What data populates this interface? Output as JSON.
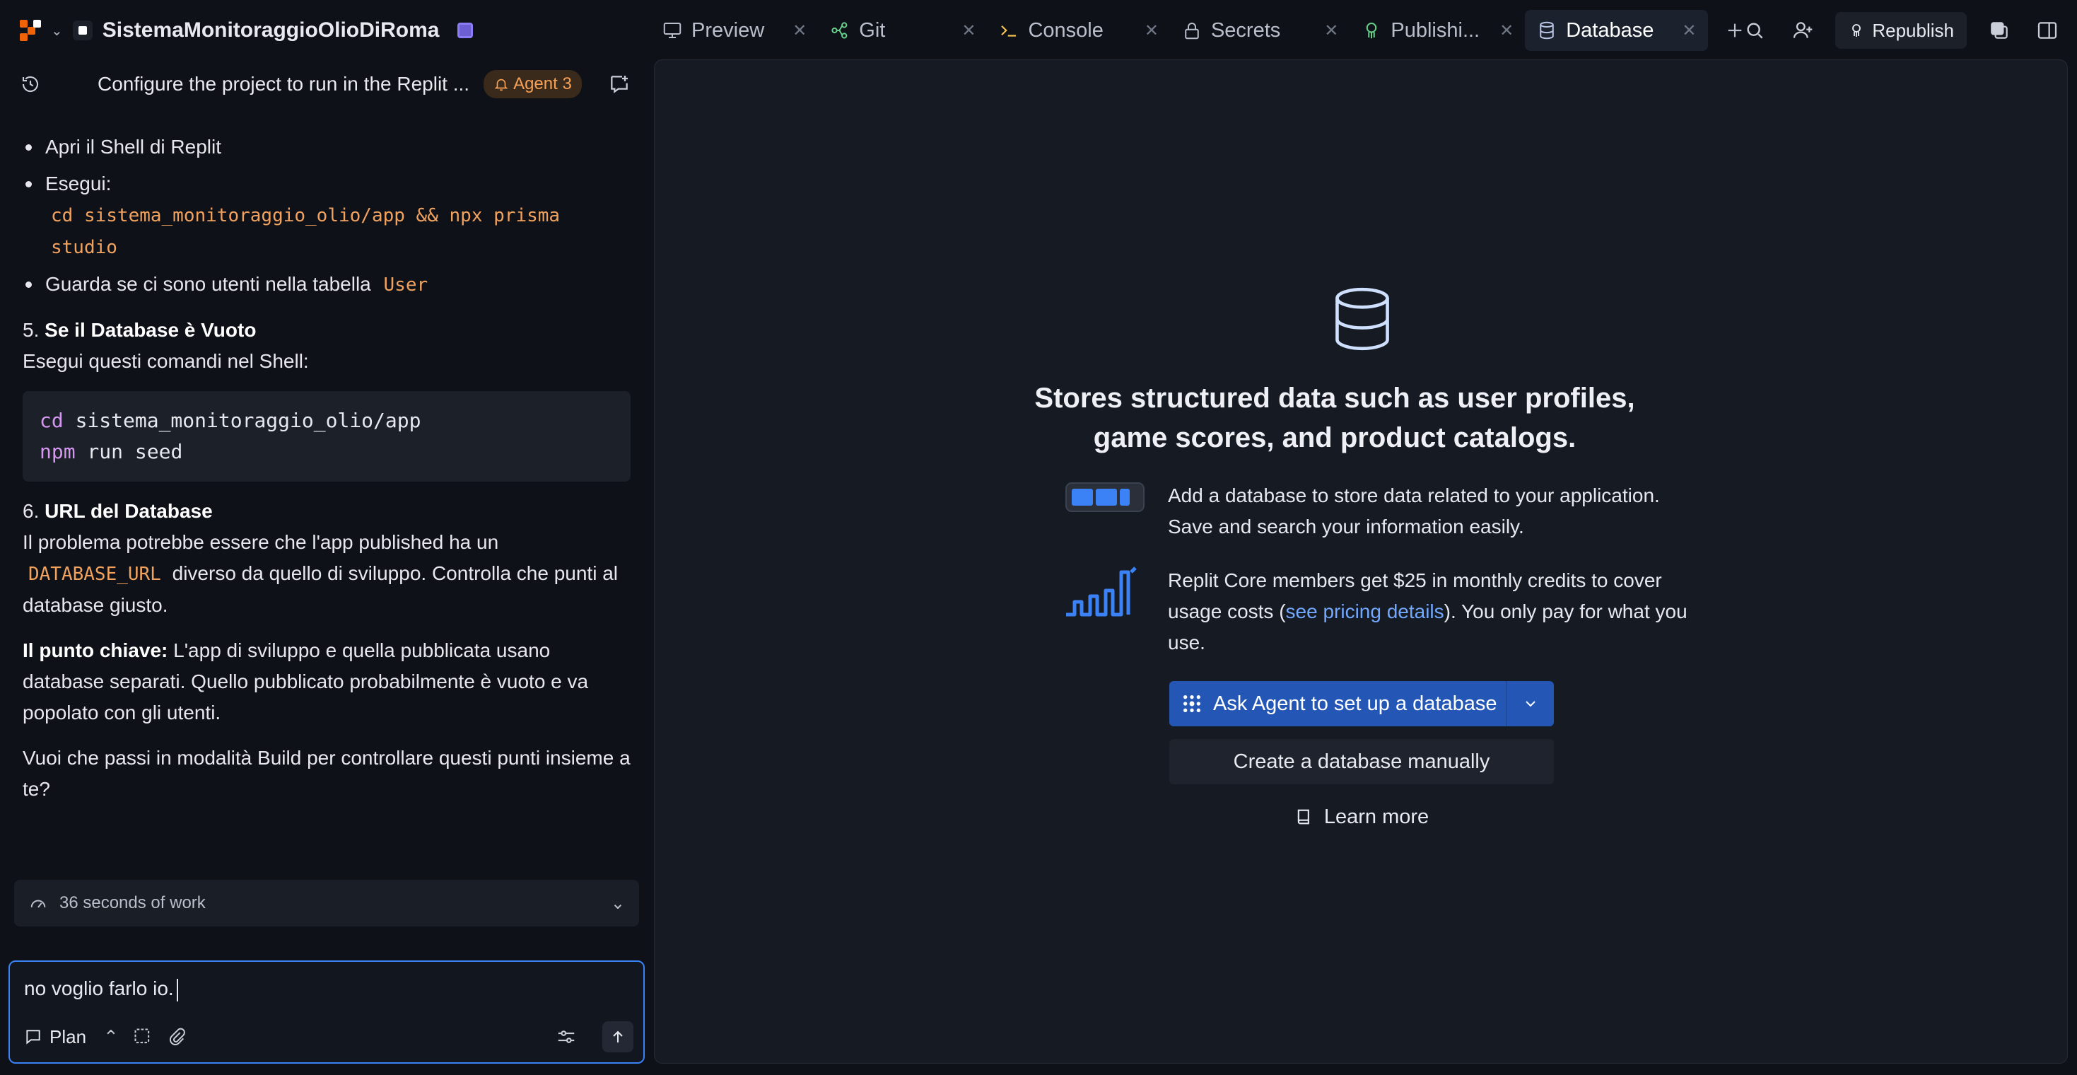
{
  "project": {
    "name": "SistemaMonitoraggioOlioDiRoma"
  },
  "tabs": [
    {
      "label": "Preview",
      "icon": "monitor-icon",
      "active": false
    },
    {
      "label": "Git",
      "icon": "git-icon",
      "active": false
    },
    {
      "label": "Console",
      "icon": "terminal-icon",
      "active": false
    },
    {
      "label": "Secrets",
      "icon": "lock-icon",
      "active": false
    },
    {
      "label": "Publishi...",
      "icon": "publish-icon",
      "active": false
    },
    {
      "label": "Database",
      "icon": "database-icon",
      "active": true
    }
  ],
  "toolbar": {
    "republish_label": "Republish"
  },
  "chat": {
    "title": "Configure the project to run in the Replit ...",
    "agent_badge": "Agent 3",
    "bullets": {
      "b1": "Apri il Shell di Replit",
      "b2": "Esegui:",
      "b2_code_line1": "cd sistema_monitoraggio_olio/app && npx prisma",
      "b2_code_line2": "studio",
      "b3_text": "Guarda se ci sono utenti nella tabella",
      "b3_code": "User"
    },
    "section5": {
      "number": "5.",
      "title": "Se il Database è Vuoto",
      "text": "Esegui questi comandi nel Shell:",
      "code": [
        {
          "kw": "cd",
          "rest": " sistema_monitoraggio_olio/app"
        },
        {
          "kw": "npm",
          "rest": " run seed"
        }
      ]
    },
    "section6": {
      "number": "6.",
      "title": "URL del Database",
      "text1": "Il problema potrebbe essere che l'app published ha un",
      "code": "DATABASE_URL",
      "text2": "diverso da quello di sviluppo. Controlla che punti al database giusto."
    },
    "key_point": {
      "label": "Il punto chiave:",
      "text": "L'app di sviluppo e quella pubblicata usano database separati. Quello pubblicato probabilmente è vuoto e va popolato con gli utenti."
    },
    "question": "Vuoi che passi in modalità Build per controllare questi punti insieme a te?",
    "work_summary": "36 seconds of work",
    "input_value": "no voglio farlo io.",
    "mode_label": "Plan"
  },
  "database": {
    "headline_line1": "Stores structured data such as user profiles,",
    "headline_line2": "game scores, and product catalogs.",
    "feature1": "Add a database to store data related to your application. Save and search your information easily.",
    "feature2_pre": "Replit Core members get $25 in monthly credits to cover usage costs (",
    "feature2_link": "see pricing details",
    "feature2_post": "). You only pay for what you use.",
    "primary_button": "Ask Agent to set up a database",
    "secondary_button": "Create a database manually",
    "learn_more": "Learn more"
  },
  "colors": {
    "accent": "#2457b5",
    "link": "#73a8ff",
    "agent_badge": "#f6a056",
    "code_inline": "#f0a25e"
  }
}
